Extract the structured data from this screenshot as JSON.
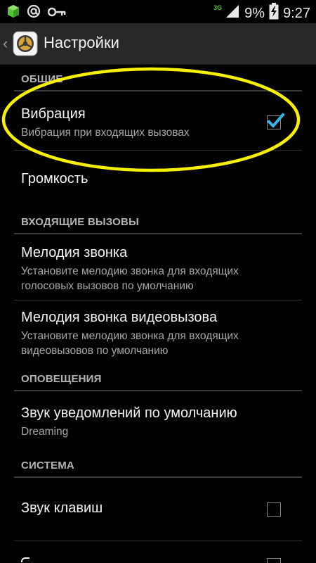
{
  "status_bar": {
    "network": "3G",
    "battery": "9%",
    "time": "9:27",
    "icons": [
      "app-notification-icon",
      "at-sign-icon",
      "key-icon",
      "signal-icon",
      "battery-icon"
    ]
  },
  "header": {
    "title": "Настройки"
  },
  "sections": {
    "general": {
      "header": "ОБЩИЕ",
      "vibration": {
        "title": "Вибрация",
        "summary": "Вибрация при входящих вызовах",
        "checked": true
      },
      "volume": {
        "title": "Громкость"
      }
    },
    "incoming": {
      "header": "ВХОДЯЩИЕ ВЫЗОВЫ",
      "ringtone": {
        "title": "Мелодия звонка",
        "summary_line1": "Установите мелодию звонка для входящих",
        "summary_line2": "голосовых вызовов по умолчанию"
      },
      "video_ringtone": {
        "title": "Мелодия звонка видеовызова",
        "summary_line1": "Установите мелодию звонка для входящих",
        "summary_line2": "видеовызовов по умолчанию"
      }
    },
    "notifications": {
      "header": "ОПОВЕЩЕНИЯ",
      "default_sound": {
        "title": "Звук уведомлений по умолчанию",
        "summary": "Dreaming"
      }
    },
    "system": {
      "header": "СИСТЕМА",
      "key_sound": {
        "title": "Звук клавиш",
        "checked": false
      },
      "next_item": {
        "checked": false
      }
    }
  },
  "colors": {
    "accent_check": "#33b5e5",
    "highlight_ellipse": "#f5f000",
    "action_bar": "#282828"
  }
}
